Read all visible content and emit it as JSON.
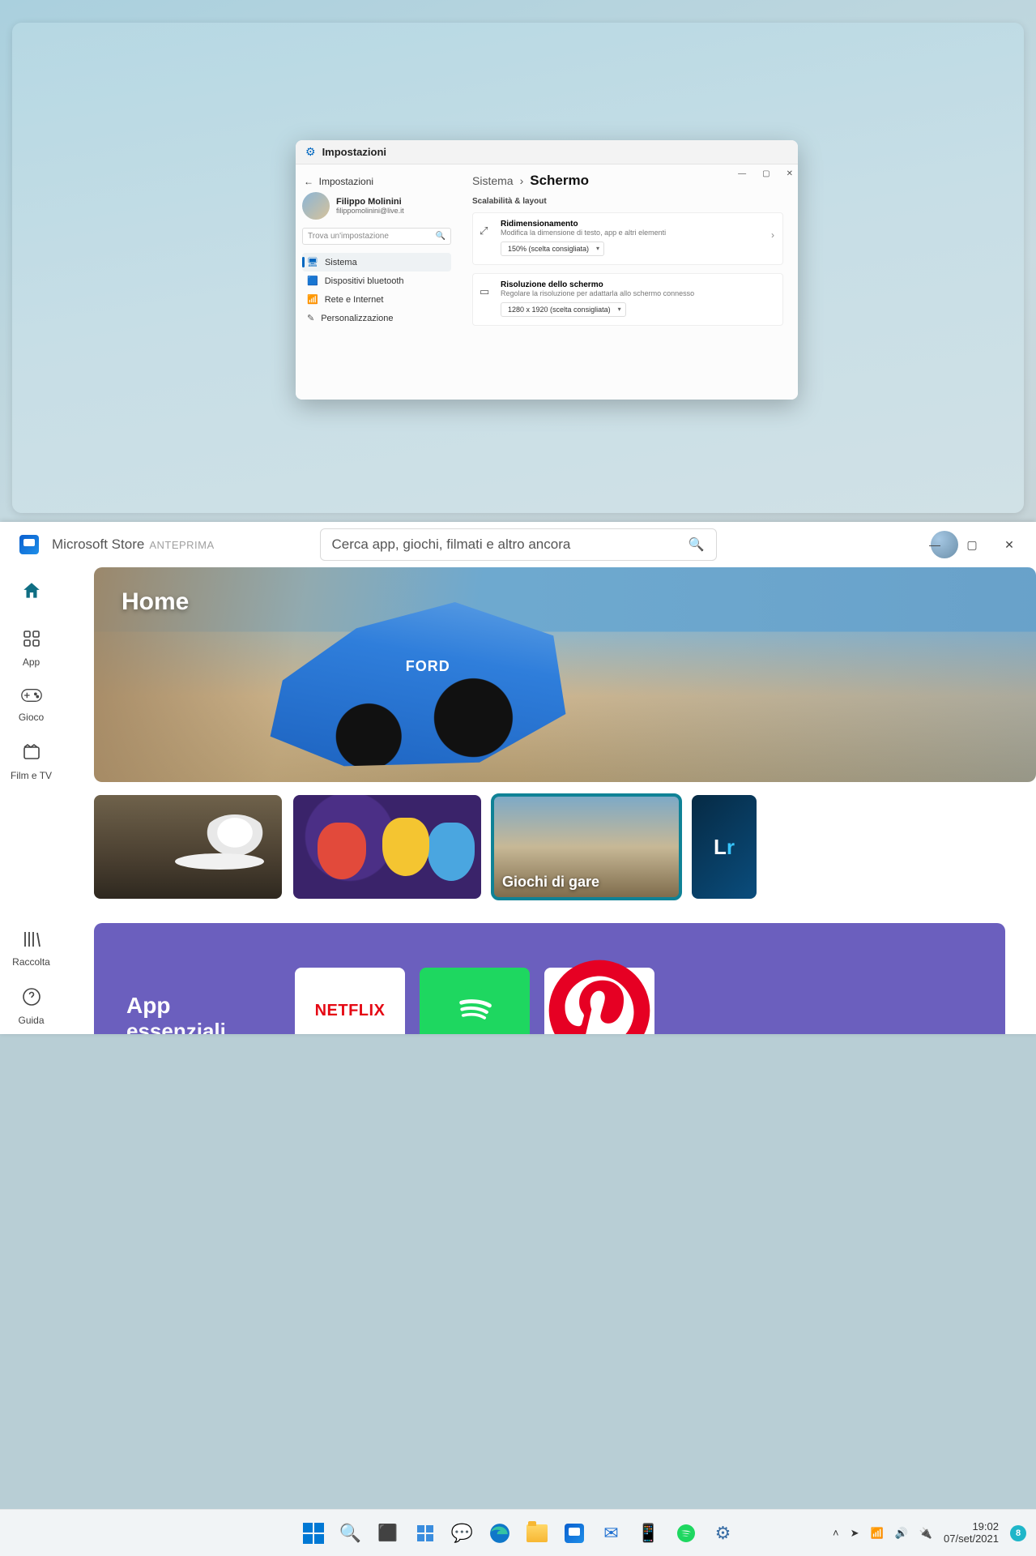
{
  "settings": {
    "windowTitle": "Impostazioni",
    "backLabel": "Impostazioni",
    "user": {
      "name": "Filippo Molinini",
      "email": "filippomolinini@live.it"
    },
    "searchPlaceholder": "Trova un'impostazione",
    "nav": {
      "sistema": "Sistema",
      "bluetooth": "Dispositivi bluetooth",
      "rete": "Rete e Internet",
      "pers": "Personalizzazione"
    },
    "breadcrumb": {
      "root": "Sistema",
      "current": "Schermo"
    },
    "sectionTitle": "Scalabilità & layout",
    "scale": {
      "title": "Ridimensionamento",
      "desc": "Modifica la dimensione di testo, app e altri elementi",
      "value": "150% (scelta consigliata)"
    },
    "resolution": {
      "title": "Risoluzione dello schermo",
      "desc": "Regolare la risoluzione per adattarla allo schermo connesso",
      "value": "1280 x 1920 (scelta consigliata)"
    }
  },
  "store": {
    "appName": "Microsoft Store",
    "badge": "ANTEPRIMA",
    "searchPlaceholder": "Cerca app, giochi, filmati e altro ancora",
    "side": {
      "home": "",
      "app": "App",
      "gioco": "Gioco",
      "film": "Film e TV",
      "raccolta": "Raccolta",
      "guida": "Guida"
    },
    "heroTitle": "Home",
    "thumbs": {
      "gare": "Giochi di gare",
      "lr1": "L",
      "lr2": "r"
    },
    "essentials": {
      "line1": "App",
      "line2": "essenziali",
      "netflix": "NETFLIX"
    }
  },
  "taskbar": {
    "time": "19:02",
    "date": "07/set/2021",
    "notifCount": "8"
  }
}
